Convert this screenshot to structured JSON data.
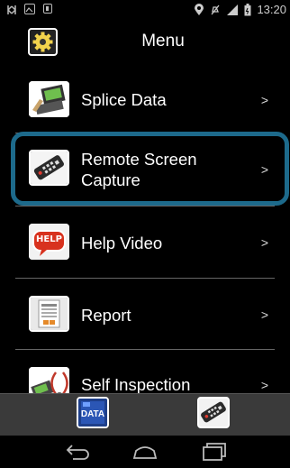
{
  "status_bar": {
    "time": "13:20",
    "icons": [
      "notification-icon",
      "image-icon",
      "clipboard-icon",
      "location-icon",
      "mute-icon",
      "signal-icon",
      "battery-icon"
    ]
  },
  "title_bar": {
    "title": "Menu",
    "settings_icon": "gear-icon"
  },
  "menu": {
    "chevron": ">",
    "items": [
      {
        "label": "Splice Data",
        "icon": "splice-data-icon"
      },
      {
        "label": "Remote Screen Capture",
        "icon": "remote-control-icon",
        "highlighted": true
      },
      {
        "label": "Help Video",
        "icon": "help-icon",
        "badge": "HELP"
      },
      {
        "label": "Report",
        "icon": "report-icon"
      },
      {
        "label": "Self Inspection",
        "icon": "self-inspection-icon"
      }
    ]
  },
  "toolbar": {
    "data_label": "DATA",
    "data_icon": "data-icon",
    "remote_icon": "remote-control-icon"
  },
  "nav_bar": {
    "buttons": [
      "back-icon",
      "home-icon",
      "recents-icon"
    ]
  },
  "colors": {
    "highlight_border": "#1d6a8b",
    "toolbar_bg": "#3a3a3a",
    "help_badge": "#d8321e",
    "data_button": "#1e3f8a"
  }
}
